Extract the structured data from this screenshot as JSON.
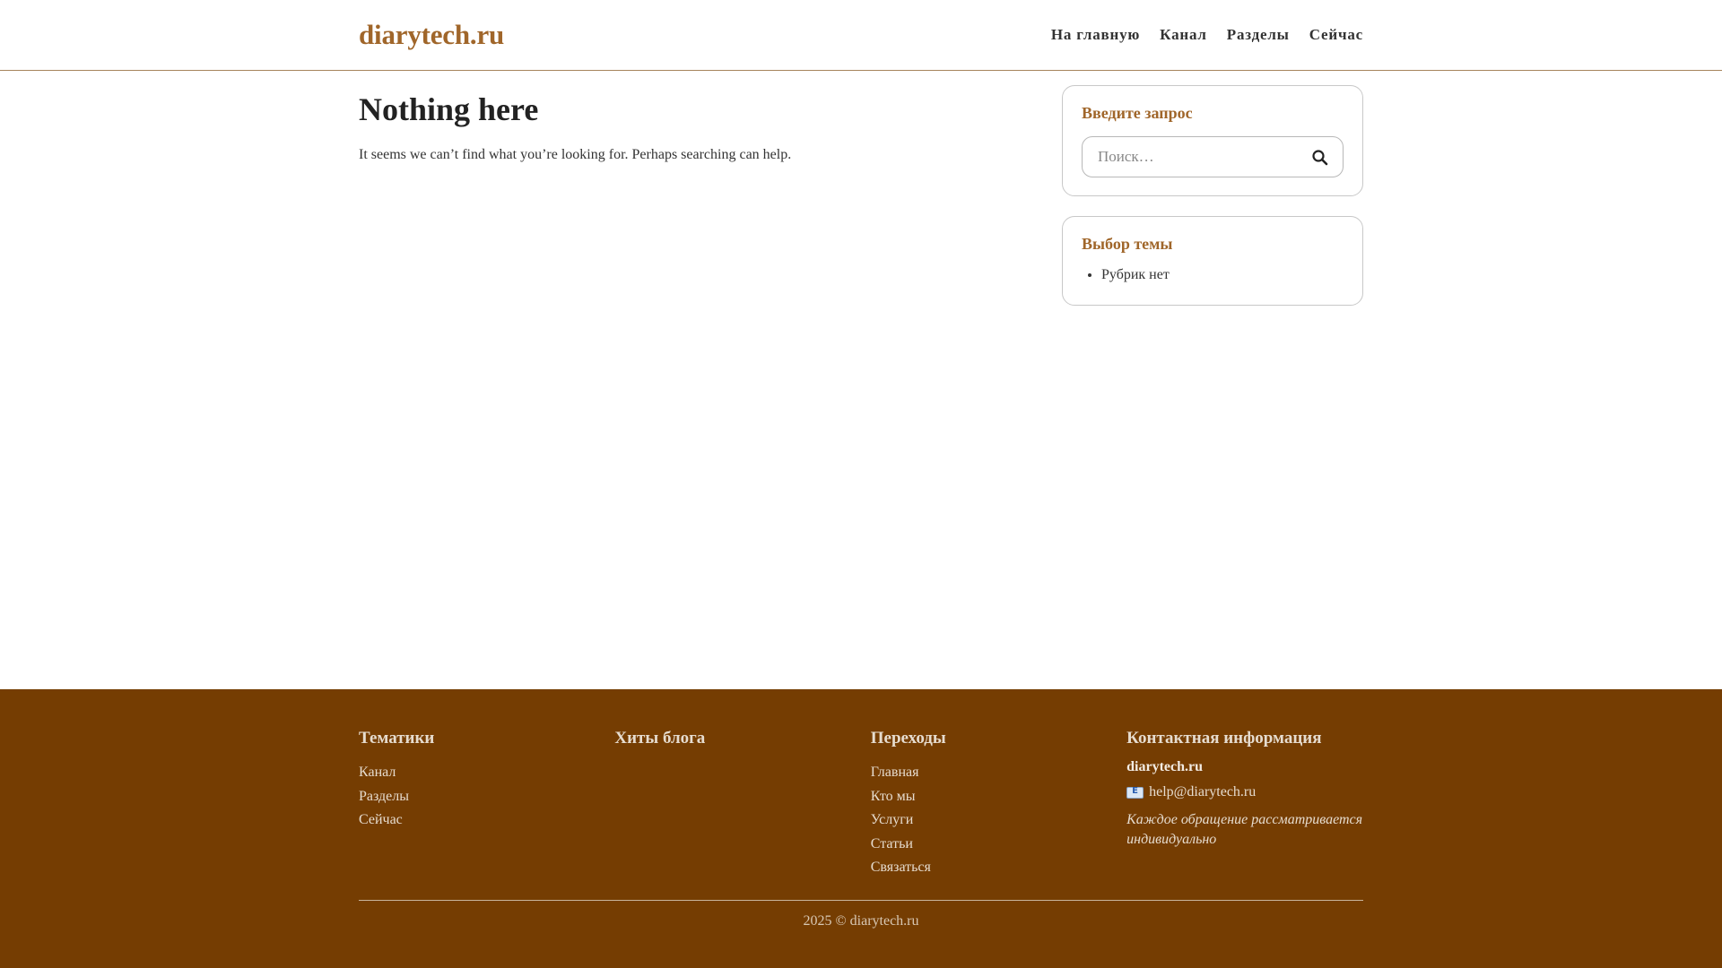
{
  "header": {
    "site_title": "diarytech.ru",
    "nav": [
      {
        "label": "На главную"
      },
      {
        "label": "Канал"
      },
      {
        "label": "Разделы"
      },
      {
        "label": "Сейчас"
      }
    ]
  },
  "main": {
    "heading": "Nothing here",
    "text": "It seems we can’t find what you’re looking for. Perhaps searching can help."
  },
  "sidebar": {
    "search_widget": {
      "title": "Введите запрос",
      "placeholder": "Поиск…",
      "icon": "search-icon"
    },
    "categories_widget": {
      "title": "Выбор темы",
      "items": [
        {
          "label": "Рубрик нет"
        }
      ]
    }
  },
  "footer": {
    "topics": {
      "heading": "Тематики",
      "links": [
        {
          "label": "Канал"
        },
        {
          "label": "Разделы"
        },
        {
          "label": "Сейчас"
        }
      ]
    },
    "hits": {
      "heading": "Хиты блога"
    },
    "transitions": {
      "heading": "Переходы",
      "links": [
        {
          "label": "Главная"
        },
        {
          "label": "Кто мы"
        },
        {
          "label": "Услуги"
        },
        {
          "label": "Статьи"
        },
        {
          "label": "Связаться"
        }
      ]
    },
    "contact": {
      "heading": "Контактная информация",
      "site": "diarytech.ru",
      "email": "help@diarytech.ru",
      "note": "Каждое обращение рассматривается индивидуально"
    },
    "copyright": "2025 © diarytech.ru"
  },
  "colors": {
    "accent": "#a0662a",
    "footer_bg": "#753d02"
  }
}
